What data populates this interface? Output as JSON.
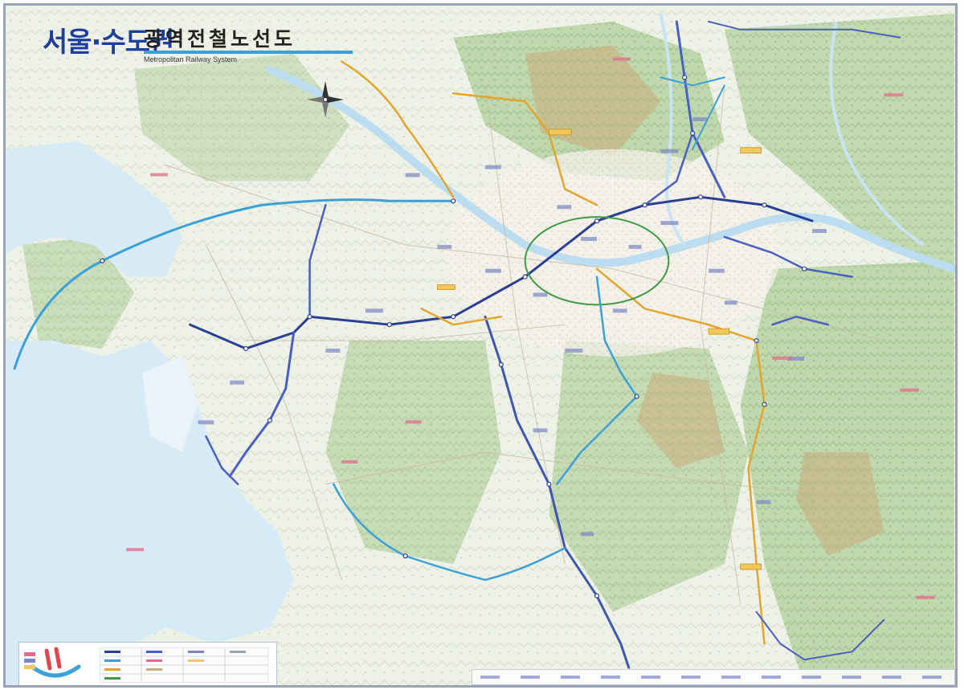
{
  "title": {
    "main": "서울·수도권",
    "sub": "광역전철노선도",
    "english": "Metropolitan Railway System"
  },
  "colors": {
    "line_blue": "#4a5fc1",
    "line_navy": "#2a3f93",
    "line_orange": "#e3a52b",
    "line_sky": "#3aa0d8",
    "line_green": "#3f9a45",
    "water": "#d7ebf7",
    "land": "#f3f0e8",
    "mountain": "#b9d4a7",
    "mountain_dark": "#8fb980",
    "hill_brown": "#c9ab7b",
    "title_blue": "#1f3f9e"
  },
  "icons": {
    "compass": "compass-rose-icon",
    "logo": "railway-logo-icon"
  }
}
